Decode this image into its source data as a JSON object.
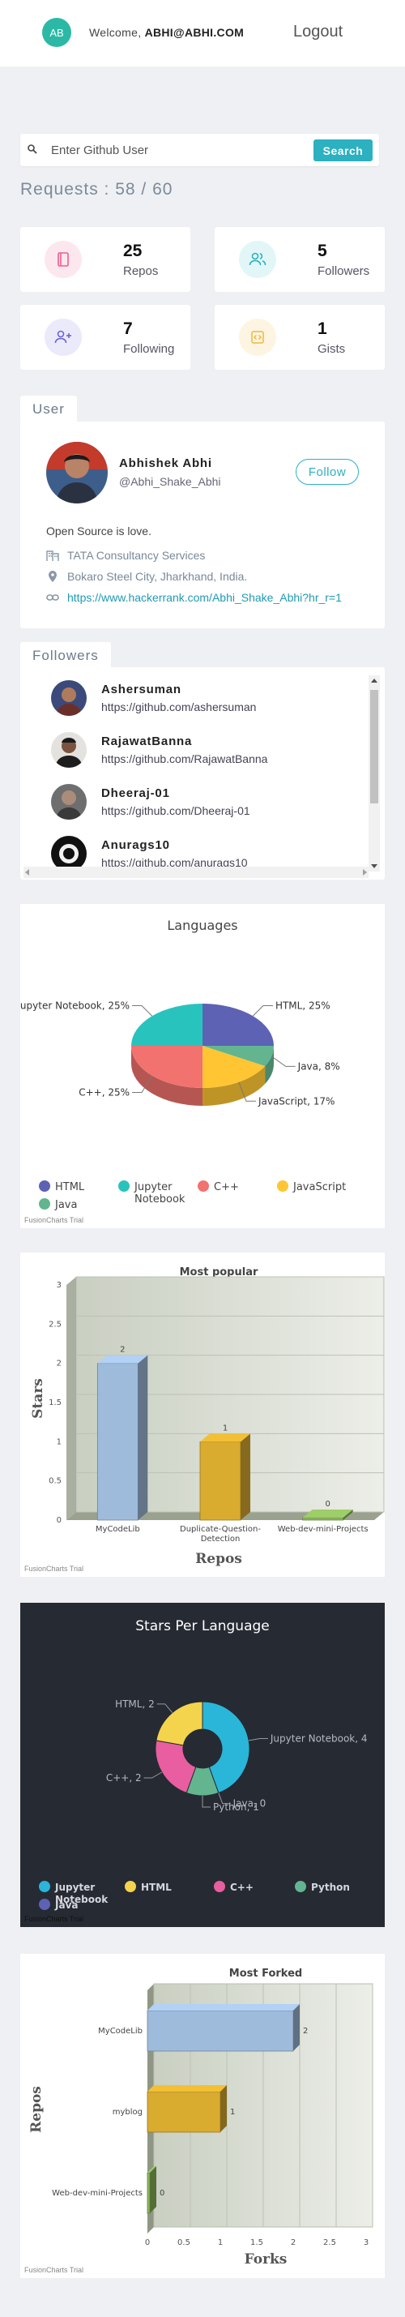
{
  "header": {
    "avatar_initials": "AB",
    "welcome_prefix": "Welcome, ",
    "user_email": "ABHI@ABHI.COM",
    "logout_label": "Logout"
  },
  "search": {
    "placeholder": "Enter Github User",
    "button_label": "Search"
  },
  "requests": {
    "label": "Requests : 58 / 60"
  },
  "stats": [
    {
      "value": "25",
      "label": "Repos",
      "icon": "book-icon",
      "color": "#ef5d8d",
      "bg": "#fde7ef"
    },
    {
      "value": "5",
      "label": "Followers",
      "icon": "users-icon",
      "color": "#2bb1c0",
      "bg": "#e2f6f8"
    },
    {
      "value": "7",
      "label": "Following",
      "icon": "user-plus-icon",
      "color": "#6c63d8",
      "bg": "#ebeafb"
    },
    {
      "value": "1",
      "label": "Gists",
      "icon": "code-icon",
      "color": "#f0b83b",
      "bg": "#fdf5e2"
    }
  ],
  "user": {
    "tab_label": "User",
    "name": "Abhishek Abhi",
    "login": "@Abhi_Shake_Abhi",
    "follow_label": "Follow",
    "bio": "Open Source is love.",
    "company": "TATA Consultancy Services",
    "location": "Bokaro Steel City, Jharkhand, India.",
    "blog": "https://www.hackerrank.com/Abhi_Shake_Abhi?hr_r=1"
  },
  "followers": {
    "tab_label": "Followers",
    "items": [
      {
        "name": "Ashersuman",
        "url": "https://github.com/ashersuman"
      },
      {
        "name": "RajawatBanna",
        "url": "https://github.com/RajawatBanna"
      },
      {
        "name": "Dheeraj-01",
        "url": "https://github.com/Dheeraj-01"
      },
      {
        "name": "Anurags10",
        "url": "https://github.com/anurags10"
      }
    ]
  },
  "trial_label": "FusionCharts Trial",
  "chart_data": [
    {
      "type": "pie",
      "title": "Languages",
      "categories": [
        "HTML",
        "Java",
        "JavaScript",
        "C++",
        "Jupyter Notebook"
      ],
      "values": [
        25,
        8,
        17,
        25,
        25
      ],
      "slice_labels": [
        "HTML, 25%",
        "Java, 8%",
        "JavaScript, 17%",
        "C++, 25%",
        "Jupyter Notebook, 25%"
      ],
      "colors": [
        "#5d62b5",
        "#62b58f",
        "#ffc533",
        "#f2726f",
        "#29c3be"
      ],
      "legend": [
        {
          "label": "HTML",
          "color": "#5d62b5"
        },
        {
          "label": "Jupyter Notebook",
          "color": "#29c3be"
        },
        {
          "label": "C++",
          "color": "#f2726f"
        },
        {
          "label": "JavaScript",
          "color": "#ffc533"
        },
        {
          "label": "Java",
          "color": "#62b58f"
        }
      ],
      "legend_position": "bottom"
    },
    {
      "type": "bar",
      "title": "Most popular",
      "categories": [
        "MyCodeLib",
        "Duplicate-Question-Detection",
        "Web-dev-mini-Projects"
      ],
      "category_labels": [
        [
          "MyCodeLib"
        ],
        [
          "Duplicate-Question-",
          "Detection"
        ],
        [
          "Web-dev-mini-Projects"
        ]
      ],
      "values": [
        2,
        1,
        0
      ],
      "colors": [
        "#9fbbdb",
        "#d9ab2f",
        "#8cb85c"
      ],
      "xlabel": "Repos",
      "ylabel": "Stars",
      "ylim": [
        0,
        3
      ],
      "yticks": [
        "0",
        "0.5",
        "1",
        "1.5",
        "2",
        "2.5",
        "3"
      ]
    },
    {
      "type": "pie",
      "title": "Stars Per Language",
      "categories": [
        "Jupyter Notebook",
        "Java",
        "Python",
        "C++",
        "HTML"
      ],
      "values": [
        4,
        0,
        1,
        2,
        2
      ],
      "slice_labels": [
        "Jupyter Notebook, 4",
        "Java, 0",
        "Python, 1",
        "C++, 2",
        "HTML, 2"
      ],
      "colors": [
        "#29b6d8",
        "#5d62b5",
        "#62b58f",
        "#e85ea0",
        "#f4d44c"
      ],
      "legend": [
        {
          "label": "Jupyter Notebook",
          "color": "#29b6d8"
        },
        {
          "label": "HTML",
          "color": "#f4d44c"
        },
        {
          "label": "C++",
          "color": "#e85ea0"
        },
        {
          "label": "Python",
          "color": "#62b58f"
        },
        {
          "label": "Java",
          "color": "#5d62b5"
        }
      ],
      "legend_position": "bottom",
      "background": "#262a33"
    },
    {
      "type": "bar",
      "orientation": "horizontal",
      "title": "Most Forked",
      "categories": [
        "MyCodeLib",
        "myblog",
        "Web-dev-mini-Projects"
      ],
      "values": [
        2,
        1,
        0
      ],
      "colors": [
        "#9fbbdb",
        "#d9ab2f",
        "#8cb85c"
      ],
      "xlabel": "Forks",
      "ylabel": "Repos",
      "xlim": [
        0,
        3
      ],
      "xticks": [
        "0",
        "0.5",
        "1",
        "1.5",
        "2",
        "2.5",
        "3"
      ]
    }
  ]
}
